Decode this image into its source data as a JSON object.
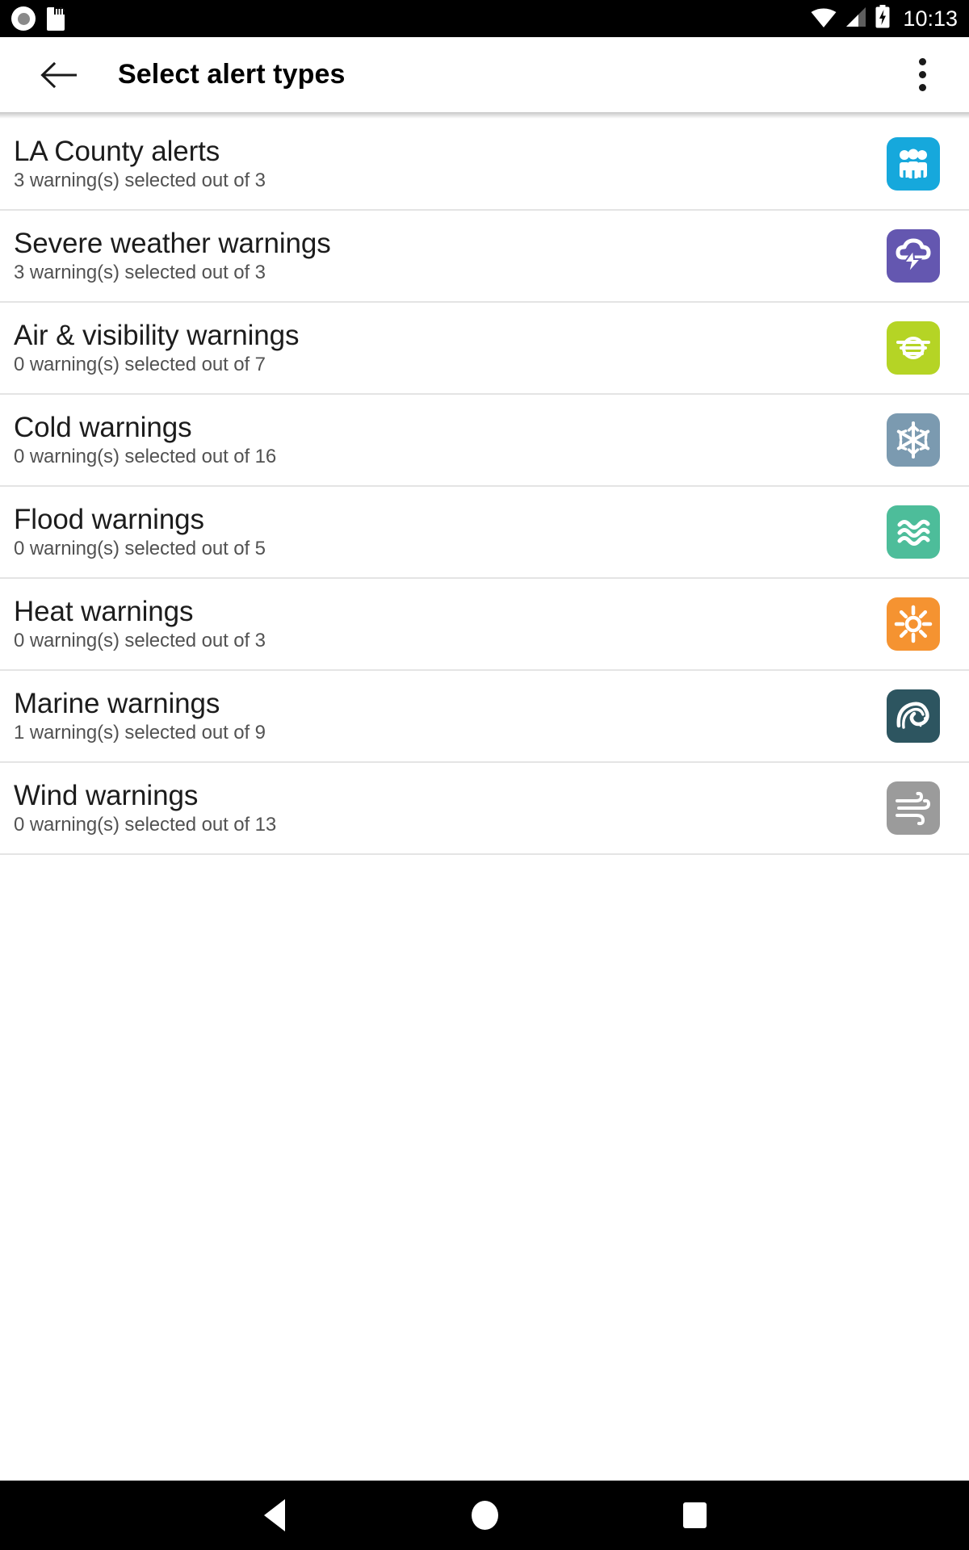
{
  "status_bar": {
    "time": "10:13",
    "left_icons": [
      "screen-record-icon",
      "sd-card-icon"
    ],
    "right_icons": [
      "wifi-icon",
      "cellular-signal-icon",
      "battery-charging-icon"
    ],
    "background": "#000000"
  },
  "app_bar": {
    "back_icon": "back-arrow-icon",
    "title": "Select alert types",
    "overflow_icon": "overflow-menu-icon"
  },
  "list": {
    "items": [
      {
        "title": "LA County alerts",
        "subtitle": "3 warning(s) selected out of 3",
        "selected": 3,
        "total": 3,
        "icon": "group-people-icon",
        "icon_color": "#16a8dc"
      },
      {
        "title": "Severe weather warnings",
        "subtitle": "3 warning(s) selected out of 3",
        "selected": 3,
        "total": 3,
        "icon": "thunderstorm-cloud-icon",
        "icon_color": "#6457b0"
      },
      {
        "title": "Air & visibility warnings",
        "subtitle": "0 warning(s) selected out of 7",
        "selected": 0,
        "total": 7,
        "icon": "haze-fog-icon",
        "icon_color": "#b5d425"
      },
      {
        "title": "Cold warnings",
        "subtitle": "0 warning(s) selected out of 16",
        "selected": 0,
        "total": 16,
        "icon": "snowflake-icon",
        "icon_color": "#7b9ab0"
      },
      {
        "title": "Flood warnings",
        "subtitle": "0 warning(s) selected out of 5",
        "selected": 0,
        "total": 5,
        "icon": "water-waves-icon",
        "icon_color": "#4dbd9a"
      },
      {
        "title": "Heat warnings",
        "subtitle": "0 warning(s) selected out of 3",
        "selected": 0,
        "total": 3,
        "icon": "sun-icon",
        "icon_color": "#f59331"
      },
      {
        "title": "Marine warnings",
        "subtitle": "1 warning(s) selected out of 9",
        "selected": 1,
        "total": 9,
        "icon": "ocean-wave-icon",
        "icon_color": "#2d5560"
      },
      {
        "title": "Wind warnings",
        "subtitle": "0 warning(s) selected out of 13",
        "selected": 0,
        "total": 13,
        "icon": "wind-icon",
        "icon_color": "#9b9b9b"
      }
    ]
  },
  "nav_bar": {
    "back_label": "back-triangle-icon",
    "home_label": "home-circle-icon",
    "recents_label": "recents-square-icon",
    "background": "#000000"
  }
}
